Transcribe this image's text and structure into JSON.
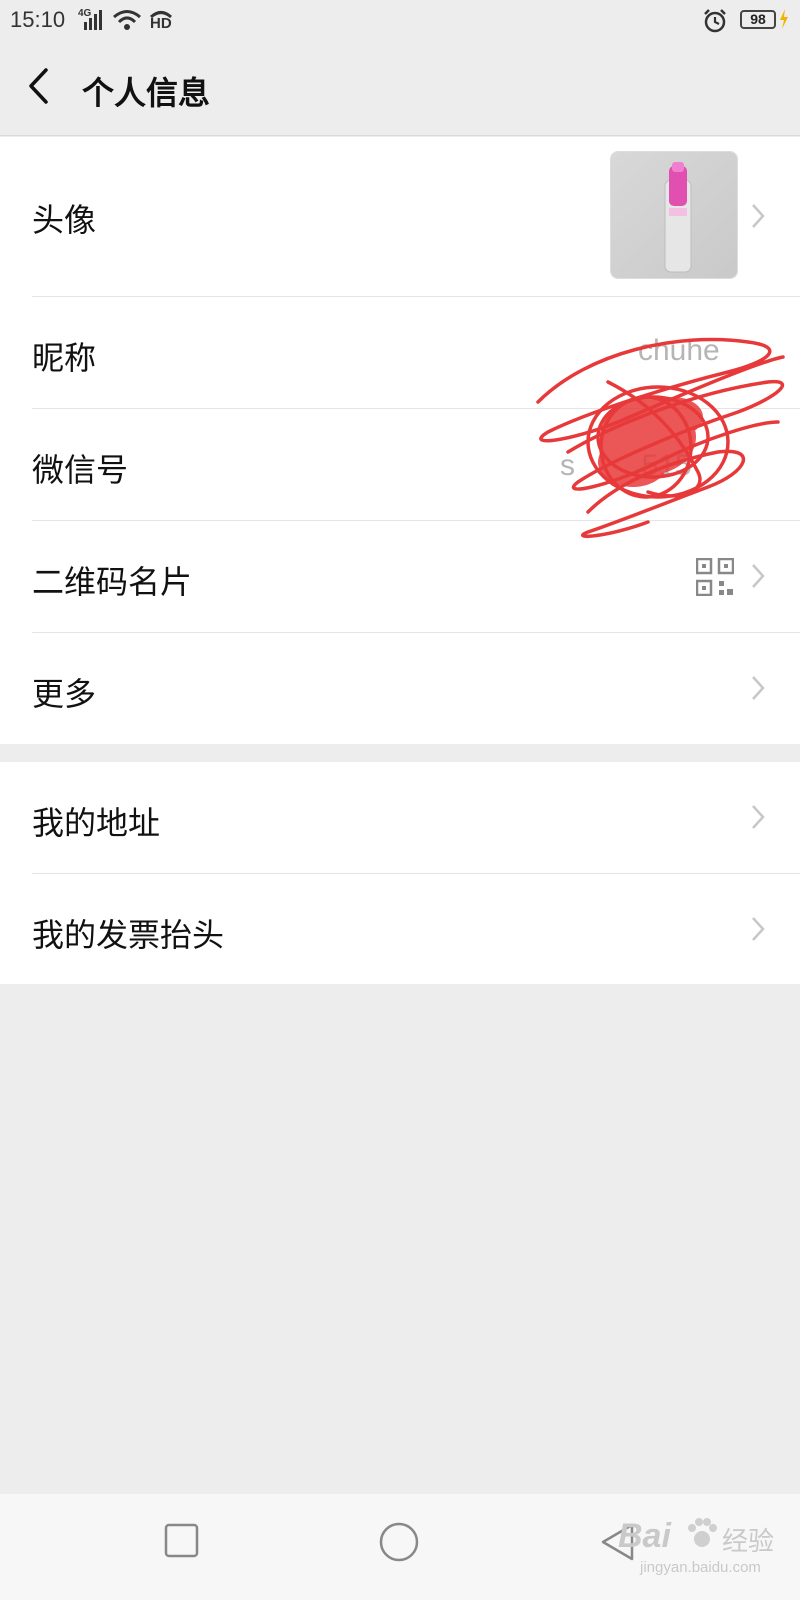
{
  "status_bar": {
    "time": "15:10",
    "network": "4G",
    "hd": "HD",
    "battery": "98"
  },
  "header": {
    "title": "个人信息"
  },
  "profile": {
    "avatar_label": "头像",
    "nickname_label": "昵称",
    "nickname_value": "chuhe",
    "wechat_id_label": "微信号",
    "wechat_id_value": "s        515",
    "qr_label": "二维码名片",
    "more_label": "更多"
  },
  "secondary": {
    "address_label": "我的地址",
    "invoice_label": "我的发票抬头"
  },
  "watermark": {
    "brand": "Bai",
    "brand_cn": "经验",
    "url": "jingyan.baidu.com"
  },
  "colors": {
    "background": "#ededed",
    "card": "#ffffff",
    "chevron": "#c7c7c7",
    "scribble": "#e8393a"
  }
}
